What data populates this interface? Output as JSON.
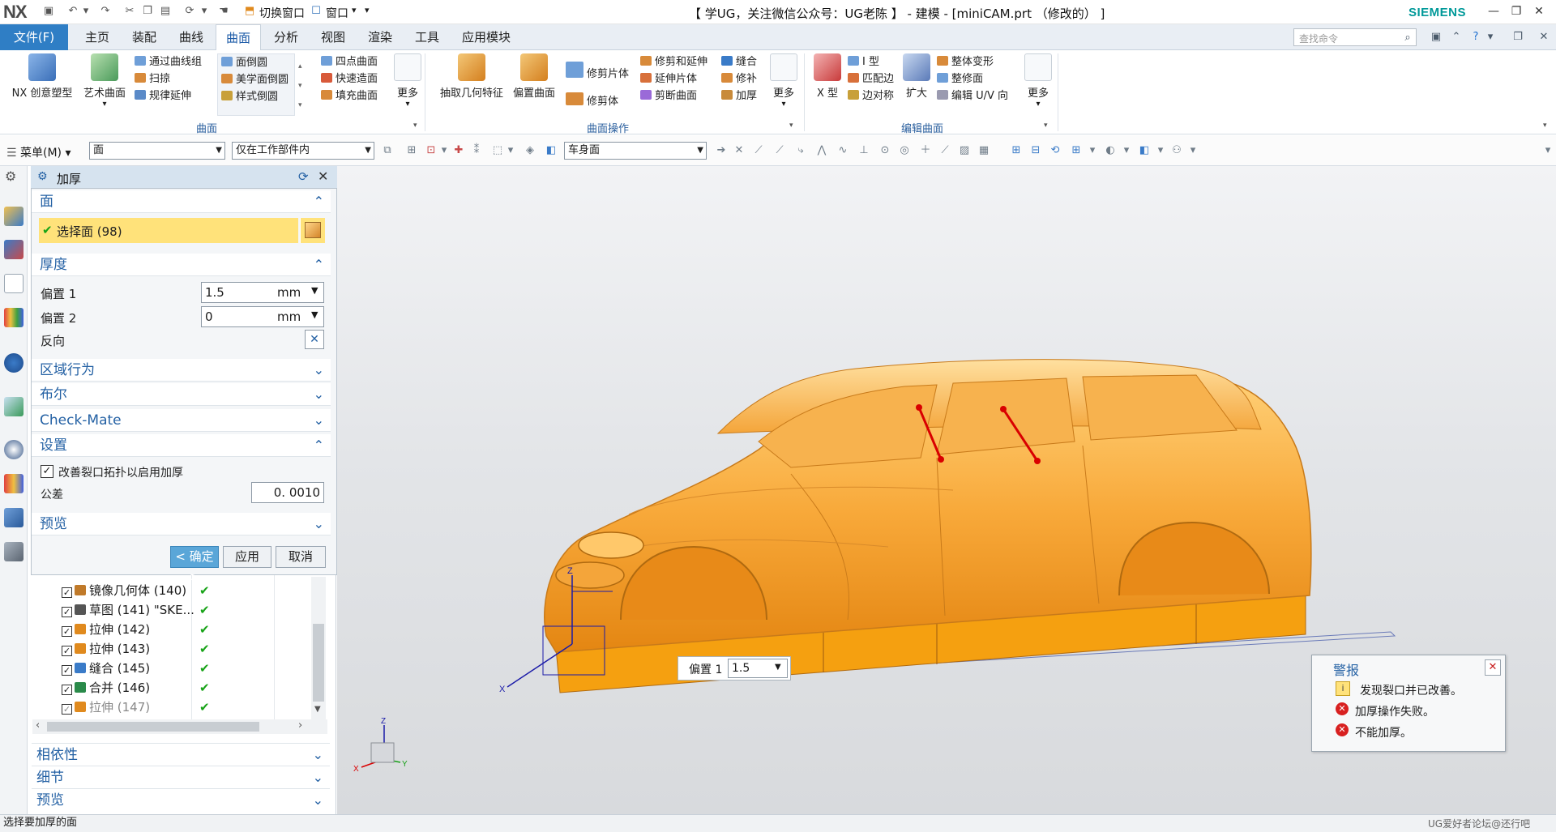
{
  "app": {
    "logo": "NX",
    "window_title": "【 学UG，关注微信公众号：UG老陈 】 - 建模 - [miniCAM.prt （修改的） ]",
    "brand": "SIEMENS",
    "quick_access": {
      "switch_window": "切换窗口",
      "window": "窗口"
    }
  },
  "menu": {
    "file": "文件(F)",
    "tabs": [
      "主页",
      "装配",
      "曲线",
      "曲面",
      "分析",
      "视图",
      "渲染",
      "工具",
      "应用模块"
    ],
    "active_tab": "曲面",
    "search_placeholder": "查找命令"
  },
  "ribbon": {
    "group1": {
      "label": "曲面",
      "big": [
        "NX 创意塑型",
        "艺术曲面"
      ],
      "col1": [
        "通过曲线组",
        "扫掠",
        "规律延伸"
      ],
      "col2": [
        "面倒圆",
        "美学面倒圆",
        "样式倒圆"
      ],
      "col3": [
        "四点曲面",
        "快速造面",
        "填充曲面"
      ],
      "more": "更多"
    },
    "group2": {
      "label": "曲面操作",
      "big": [
        "抽取几何特征",
        "偏置曲面"
      ],
      "col0": [
        "修剪片体",
        "修剪体"
      ],
      "col1": [
        "修剪和延伸",
        "延伸片体",
        "剪断曲面"
      ],
      "col2": [
        "缝合",
        "修补",
        "加厚"
      ],
      "more": "更多"
    },
    "group3": {
      "label": "编辑曲面",
      "big": [
        "X 型",
        "扩大"
      ],
      "col1": [
        "I 型",
        "匹配边",
        "边对称"
      ],
      "col2": [
        "整体变形",
        "整修面",
        "编辑 U/V 向"
      ],
      "more": "更多"
    }
  },
  "toolbar": {
    "menu_button": "菜单(M)",
    "filter_type": "面",
    "scope": "仅在工作部件内",
    "face_rule": "车身面"
  },
  "dialog": {
    "title": "加厚",
    "face_section": "面",
    "select_face": "选择面 (98)",
    "thickness_section": "厚度",
    "offset1_label": "偏置 1",
    "offset1_value": "1.5",
    "offset1_unit": "mm",
    "offset2_label": "偏置 2",
    "offset2_value": "0",
    "offset2_unit": "mm",
    "reverse_label": "反向",
    "region_section": "区域行为",
    "boolean_section": "布尔",
    "checkmate_section": "Check-Mate",
    "settings_section": "设置",
    "improve_label": "改善裂口拓扑以启用加厚",
    "tolerance_label": "公差",
    "tolerance_value": "0. 0010",
    "preview_section": "预览",
    "ok": "< 确定 >",
    "apply": "应用",
    "cancel": "取消"
  },
  "navigator": {
    "rows": [
      {
        "label": "镜像几何体 (140)",
        "color": "#c07a2a"
      },
      {
        "label": "草图 (141) \"SKE...",
        "color": "#444444"
      },
      {
        "label": "拉伸 (142)",
        "color": "#e08a1e"
      },
      {
        "label": "拉伸 (143)",
        "color": "#e08a1e"
      },
      {
        "label": "缝合 (145)",
        "color": "#3a7bc8"
      },
      {
        "label": "合并 (146)",
        "color": "#2a8a4a"
      },
      {
        "label": "拉伸 (147)",
        "color": "#e08a1e"
      }
    ],
    "check": "✔",
    "sections": [
      "相依性",
      "细节",
      "预览"
    ]
  },
  "viewport": {
    "offset_tag_label": "偏置 1",
    "offset_tag_value": "1.5",
    "axis_x": "X",
    "axis_y": "Y",
    "axis_z": "Z"
  },
  "alert": {
    "title": "警报",
    "messages": [
      {
        "text": "发现裂口并已改善。",
        "kind": "info"
      },
      {
        "text": "加厚操作失败。",
        "kind": "error"
      },
      {
        "text": "不能加厚。",
        "kind": "error"
      }
    ],
    "close": "✕"
  },
  "status_bar": {
    "text": "选择要加厚的面",
    "watermark": "UG爱好者论坛@还行吧"
  },
  "colors": {
    "accent": "#2f7ec5",
    "car_body": "#f5a623",
    "selection_highlight": "#ffe27a",
    "edge_red": "#d90000",
    "section_title": "#2461a4"
  }
}
